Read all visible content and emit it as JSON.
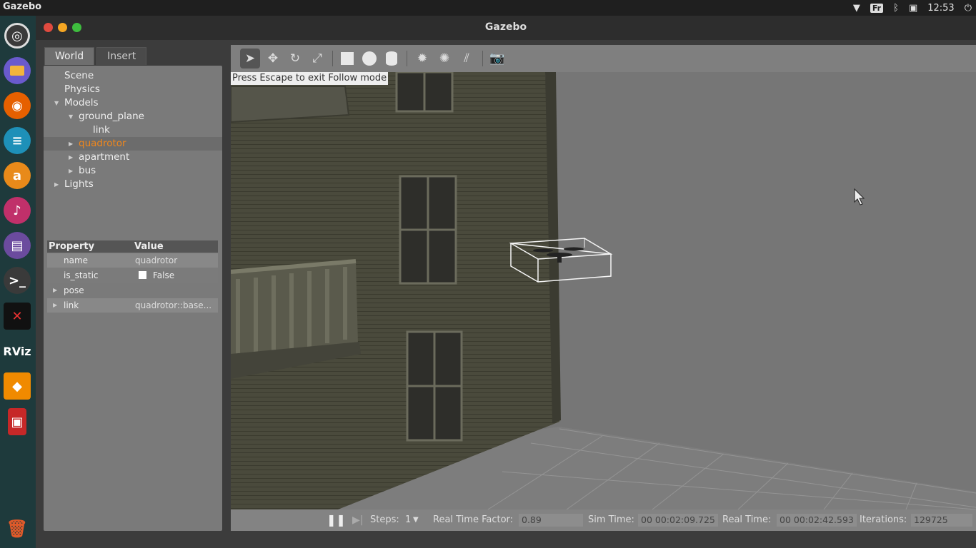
{
  "topbar": {
    "app_name": "Gazebo",
    "keyboard_layout": "Fr",
    "clock": "12:53"
  },
  "launcher": {
    "items": [
      {
        "name": "ubuntu-dash-icon",
        "color": "#dd4814"
      },
      {
        "name": "files-icon",
        "color": "#e58f1c"
      },
      {
        "name": "firefox-icon",
        "color": "#e66000"
      },
      {
        "name": "writer-icon",
        "color": "#1e90b8"
      },
      {
        "name": "software-center-icon",
        "color": "#e88a1a"
      },
      {
        "name": "music-icon",
        "color": "#c0306a"
      },
      {
        "name": "text-editor-icon",
        "color": "#6b4b9e"
      },
      {
        "name": "terminal-icon",
        "color": "#3a3a3a"
      },
      {
        "name": "x-app-icon",
        "color": "#222222"
      },
      {
        "name": "rviz-icon",
        "color": "#1e3a3c",
        "label": "RViz"
      },
      {
        "name": "gazebo-icon",
        "color": "#f08a00"
      },
      {
        "name": "pdf-icon",
        "color": "#c62828"
      },
      {
        "name": "trash-icon",
        "color": "#d84315"
      }
    ]
  },
  "window": {
    "title": "Gazebo",
    "controls": {
      "close": "#e04a3f",
      "minimize": "#f5a623",
      "maximize": "#3ebd3e"
    }
  },
  "left_tabs": {
    "world": "World",
    "insert": "Insert"
  },
  "world_tree": {
    "scene": "Scene",
    "physics": "Physics",
    "models": "Models",
    "ground_plane": "ground_plane",
    "link": "link",
    "quadrotor": "quadrotor",
    "apartment": "apartment",
    "bus": "bus",
    "lights": "Lights"
  },
  "properties": {
    "header_property": "Property",
    "header_value": "Value",
    "rows": [
      {
        "key": "name",
        "value": "quadrotor"
      },
      {
        "key": "is_static",
        "value": "False"
      },
      {
        "key": "pose",
        "value": ""
      },
      {
        "key": "link",
        "value": "quadrotor::base..."
      }
    ]
  },
  "toolbar": {
    "icons": [
      "select-arrow-icon",
      "translate-icon",
      "rotate-icon",
      "scale-icon",
      "box-shape-icon",
      "sphere-shape-icon",
      "cylinder-shape-icon",
      "sun-light-icon",
      "point-light-icon",
      "spot-light-icon",
      "camera-screenshot-icon"
    ]
  },
  "scene": {
    "hint": "Press Escape to exit Follow mode"
  },
  "statusbar": {
    "steps_label": "Steps:",
    "steps_value": "1",
    "rtf_label": "Real Time Factor:",
    "rtf_value": "0.89",
    "sim_time_label": "Sim Time:",
    "sim_time_value": "00 00:02:09.725",
    "real_time_label": "Real Time:",
    "real_time_value": "00 00:02:42.593",
    "iterations_label": "Iterations:",
    "iterations_value": "129725"
  },
  "colors": {
    "selected_model": "#f0871c"
  }
}
